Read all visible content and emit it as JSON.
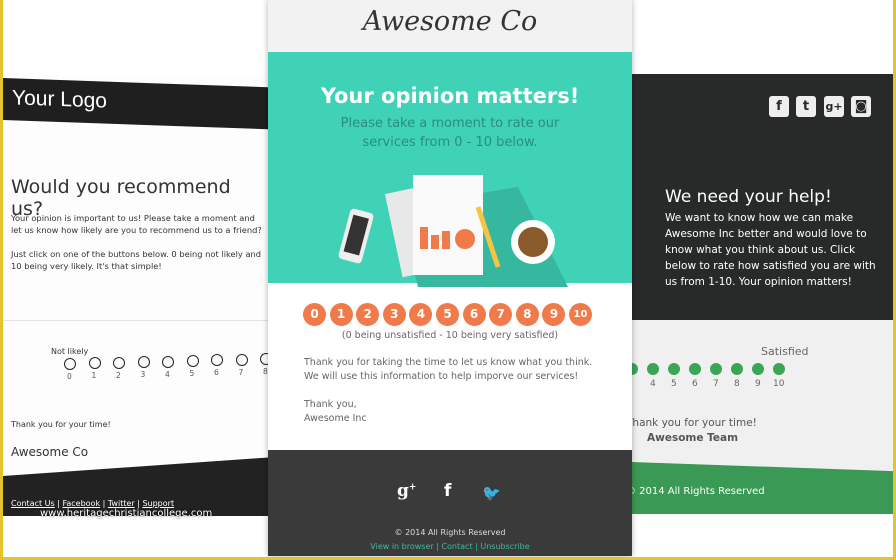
{
  "left_template": {
    "logo": "Your Logo",
    "heading": "Would you recommend us?",
    "para1": "Your opinion is important to us! Please take a moment and let us know how likely are you to recommend us to a friend?",
    "para2": "Just click on one of the buttons below. 0 being not likely and 10 being very likely. It's that simple!",
    "scale_label": "Not likely",
    "scale": [
      "0",
      "1",
      "2",
      "3",
      "4",
      "5",
      "6",
      "7",
      "8"
    ],
    "thanks": "Thank you for your time!",
    "signature": "Awesome Co",
    "footer_links": [
      "Contact Us",
      "Facebook",
      "Twitter",
      "Support"
    ]
  },
  "watermark": "www.heritagechristiancollege.com",
  "center_template": {
    "brand": "Awesome Co",
    "headline": "Your opinion matters!",
    "subheadline": "Please take a moment to rate our services from 0 - 10 below.",
    "scale": [
      "0",
      "1",
      "2",
      "3",
      "4",
      "5",
      "6",
      "7",
      "8",
      "9",
      "10"
    ],
    "scale_caption": "(0 being unsatisfied - 10 being very satisfied)",
    "body": "Thank you for taking the time to let us know what you think. We will use this information to help imporve our services!",
    "closing": "Thank you,",
    "signature": "Awesome Inc",
    "social_icons": [
      "google-plus",
      "facebook",
      "twitter"
    ],
    "copyright": "© 2014 All Rights Reserved",
    "footer_links": [
      "View in browser",
      "Contact",
      "Unsubscribe"
    ],
    "colors": {
      "teal": "#3fd2b6",
      "orange": "#f07a4a",
      "dark": "#3a3a3a"
    }
  },
  "right_template": {
    "social_icons": [
      "facebook",
      "twitter",
      "google-plus",
      "instagram"
    ],
    "heading": "We need your help!",
    "body": "We want to know how we can make Awesome Inc better and would love to know what you think about us. Click below to rate how satisfied you are with us from 1-10. Your opinion matters!",
    "scale_label": "Satisfied",
    "scale": [
      "4",
      "5",
      "6",
      "7",
      "8",
      "9",
      "10"
    ],
    "thanks": "Thank you for your time!",
    "signature": "Awesome Team",
    "copyright": "© 2014 All Rights Reserved",
    "colors": {
      "dark": "#272a28",
      "green": "#3a9a55"
    }
  }
}
